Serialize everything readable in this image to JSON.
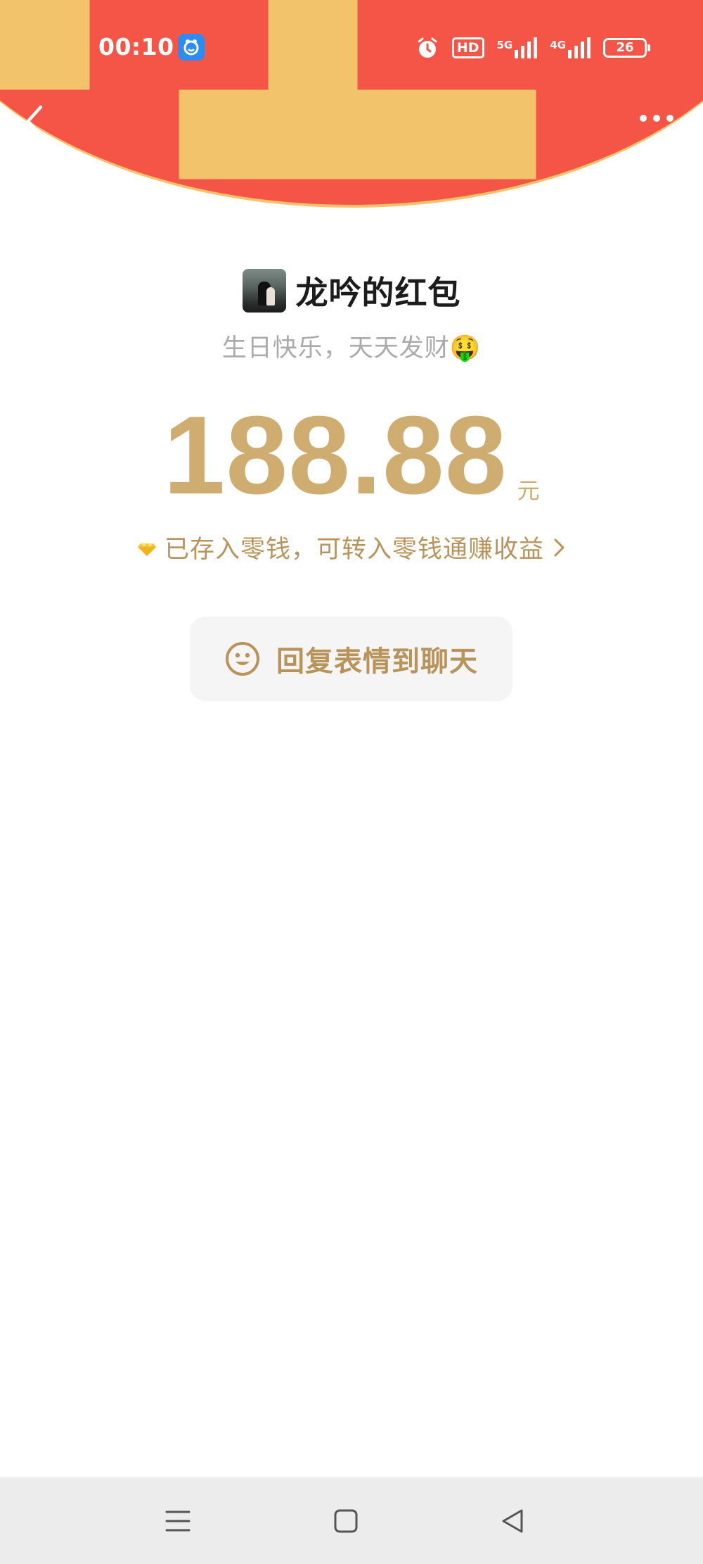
{
  "status_bar": {
    "time": "00:10",
    "hd_label": "HD",
    "net_5g": "5G",
    "net_4g": "4G",
    "battery_level": "26"
  },
  "sender": {
    "name": "龙吟的红包"
  },
  "greeting": "生日快乐，天天发财🤑",
  "amount": {
    "value": "188.88",
    "unit": "元"
  },
  "saved_notice": "已存入零钱，可转入零钱通赚收益",
  "reply_button": {
    "label": "回复表情到聊天"
  },
  "colors": {
    "header_red": "#f45547",
    "gold": "#cfac70",
    "gold_dark": "#b8935a"
  }
}
